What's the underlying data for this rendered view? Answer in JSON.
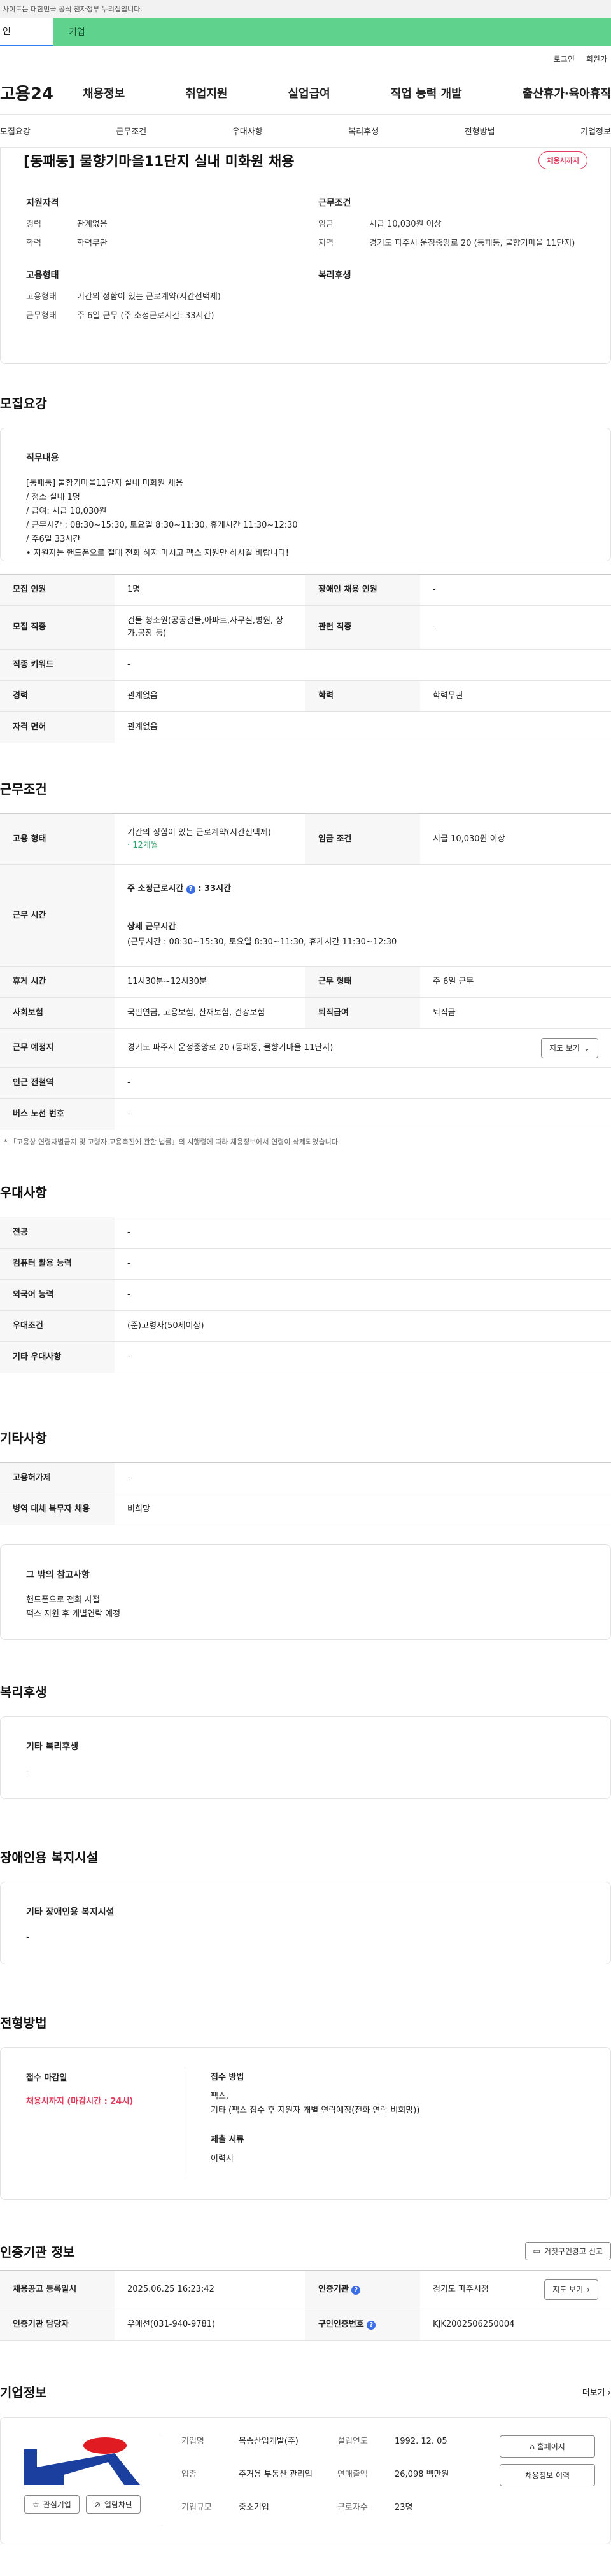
{
  "topbar": {
    "text": "사이트는 대한민국 공식 전자정부 누리집입니다."
  },
  "tabs": [
    {
      "label": "인"
    },
    {
      "label": "기업"
    }
  ],
  "util": {
    "login": "로그인",
    "join": "회원가"
  },
  "gnb": {
    "logo": "고용24",
    "menus": [
      "채용정보",
      "취업지원",
      "실업급여",
      "직업 능력 개발",
      "출산휴가·육아휴직"
    ]
  },
  "subnav": [
    "모집요강",
    "근무조건",
    "우대사항",
    "복리후생",
    "전형방법",
    "기업정보"
  ],
  "job": {
    "title": "[동패동] 물향기마을11단지 실내 미화원 채용",
    "status": "채용시까지"
  },
  "summary": {
    "qual_title": "지원자격",
    "qual": [
      {
        "k": "경력",
        "v": "관계없음"
      },
      {
        "k": "학력",
        "v": "학력무관"
      }
    ],
    "work_title": "근무조건",
    "work": [
      {
        "k": "임금",
        "v": "시급 10,030원 이상"
      },
      {
        "k": "지역",
        "v": "경기도 파주시 운정중앙로 20 (동패동, 물향기마을 11단지)"
      }
    ],
    "emp_title": "고용형태",
    "emp": [
      {
        "k": "고용형태",
        "v": "기간의 정함이 있는 근로계약(시간선택제)"
      },
      {
        "k": "근무형태",
        "v": "주 6일 근무 (주 소정근로시간: 33시간)"
      }
    ],
    "welfare_title": "복리후생"
  },
  "recruit": {
    "section": "모집요강",
    "duty_title": "직무내용",
    "duty_lines": [
      "[동패동] 물향기마을11단지 실내 미화원 채용",
      "/ 청소 실내 1명",
      "/ 급여: 시급 10,030원",
      "/ 근무시간 : 08:30~15:30, 토요일 8:30~11:30, 휴게시간 11:30~12:30",
      "/ 주6일 33시간",
      "• 지원자는 핸드폰으로 절대 전화 하지 마시고  팩스 지원만 하시길 바랍니다!"
    ],
    "rows": [
      {
        "h1": "모집 인원",
        "v1": "1명",
        "h2": "장애인 채용 인원",
        "v2": "-"
      },
      {
        "h1": "모집 직종",
        "v1": "건물 청소원(공공건물,아파트,사무실,병원, 상가,공장 등)",
        "h2": "관련 직종",
        "v2": "-"
      },
      {
        "h1": "직종 키워드",
        "v1": "-"
      },
      {
        "h1": "경력",
        "v1": "관계없음",
        "h2": "학력",
        "v2": "학력무관"
      },
      {
        "h1": "자격 면허",
        "v1": "관계없음"
      }
    ]
  },
  "conditions": {
    "section": "근무조건",
    "emp_type_h": "고용 형태",
    "emp_type_v": "기간의 정함이 있는 근로계약(시간선택제)",
    "emp_type_sub": "· 12개월",
    "wage_h": "임금 조건",
    "wage_v": "시급 10,030원 이상",
    "hours_h": "근무 시간",
    "hours_title": "주 소정근로시간",
    "hours_value": ": 33시간",
    "detail_title": "상세 근무시간",
    "detail_value": "(근무시간 : 08:30~15:30, 토요일 8:30~11:30, 휴게시간 11:30~12:30",
    "break_h": "휴게 시간",
    "break_v": "11시30분~12시30분",
    "form_h": "근무 형태",
    "form_v": "주 6일 근무",
    "ins_h": "사회보험",
    "ins_v": "국민연금, 고용보험, 산재보험, 건강보험",
    "ret_h": "퇴직급여",
    "ret_v": "퇴직금",
    "place_h": "근무 예정지",
    "place_v": "경기도 파주시 운정중앙로 20 (동패동, 물향기마을 11단지)",
    "map_btn": "지도 보기",
    "subway_h": "인근 전철역",
    "subway_v": "-",
    "bus_h": "버스 노선 번호",
    "bus_v": "-",
    "note": "「고용상 연령차별금지 및 고령자 고용촉진에 관한 법률」의 시행령에 따라 채용정보에서 연령이 삭제되었습니다."
  },
  "pref": {
    "section": "우대사항",
    "rows": [
      {
        "h": "전공",
        "v": "-"
      },
      {
        "h": "컴퓨터 활용 능력",
        "v": "-"
      },
      {
        "h": "외국어 능력",
        "v": "-"
      },
      {
        "h": "우대조건",
        "v": "(준)고령자(50세이상)"
      },
      {
        "h": "기타 우대사항",
        "v": "-"
      }
    ]
  },
  "etc": {
    "section": "기타사항",
    "rows": [
      {
        "h": "고용허가제",
        "v": "-"
      },
      {
        "h": "병역 대체 복무자 채용",
        "v": "비희망"
      }
    ],
    "box_title": "그 밖의 참고사항",
    "box_lines": [
      "핸드폰으로 전화 사절",
      "팩스 지원 후 개별연락 예정"
    ]
  },
  "welfare": {
    "section": "복리후생",
    "box_title": "기타 복리후생",
    "box_value": "-"
  },
  "disabled": {
    "section": "장애인용 복지시설",
    "box_title": "기타 장애인용 복지시설",
    "box_value": "-"
  },
  "process": {
    "section": "전형방법",
    "deadline_title": "접수 마감일",
    "deadline_value": "채용시까지 (마감시간 : 24시)",
    "method_title": "접수 방법",
    "method_lines": [
      "팩스,",
      "기타 (팩스 접수 후 지원자 개별 연락예정(전화 연락 비희망))"
    ],
    "docs_title": "제출 서류",
    "docs_value": "이력서"
  },
  "cert": {
    "section": "인증기관 정보",
    "report_btn": "거짓구인광고 신고",
    "rows": [
      {
        "h1": "채용공고 등록일시",
        "v1": "2025.06.25 16:23:42",
        "h2": "인증기관",
        "v2": "경기도 파주시청"
      },
      {
        "h1": "인증기관 담당자",
        "v1": "우애선(031-940-9781)",
        "h2": "구인인증번호",
        "v2": "KJK2002506250004"
      }
    ],
    "map_btn": "지도 보기"
  },
  "company": {
    "section": "기업정보",
    "more": "더보기",
    "fav_btn": "관심기업",
    "block_btn": "열람차단",
    "fields": [
      {
        "k": "기업명",
        "v": "목송산업개발(주)",
        "k2": "설립연도",
        "v2": "1992. 12. 05"
      },
      {
        "k": "업종",
        "v": "주거용 부동산 관리업",
        "k2": "연매출액",
        "v2": "26,098 백만원"
      },
      {
        "k": "기업규모",
        "v": "중소기업",
        "k2": "근로자수",
        "v2": "23명"
      }
    ],
    "home_btn": "홈페이지",
    "hist_btn": "채용정보 이력"
  },
  "colors": {
    "accent_red": "#e23c5d",
    "tab_green": "#5fd38d",
    "info_blue": "#3b6ee8"
  }
}
